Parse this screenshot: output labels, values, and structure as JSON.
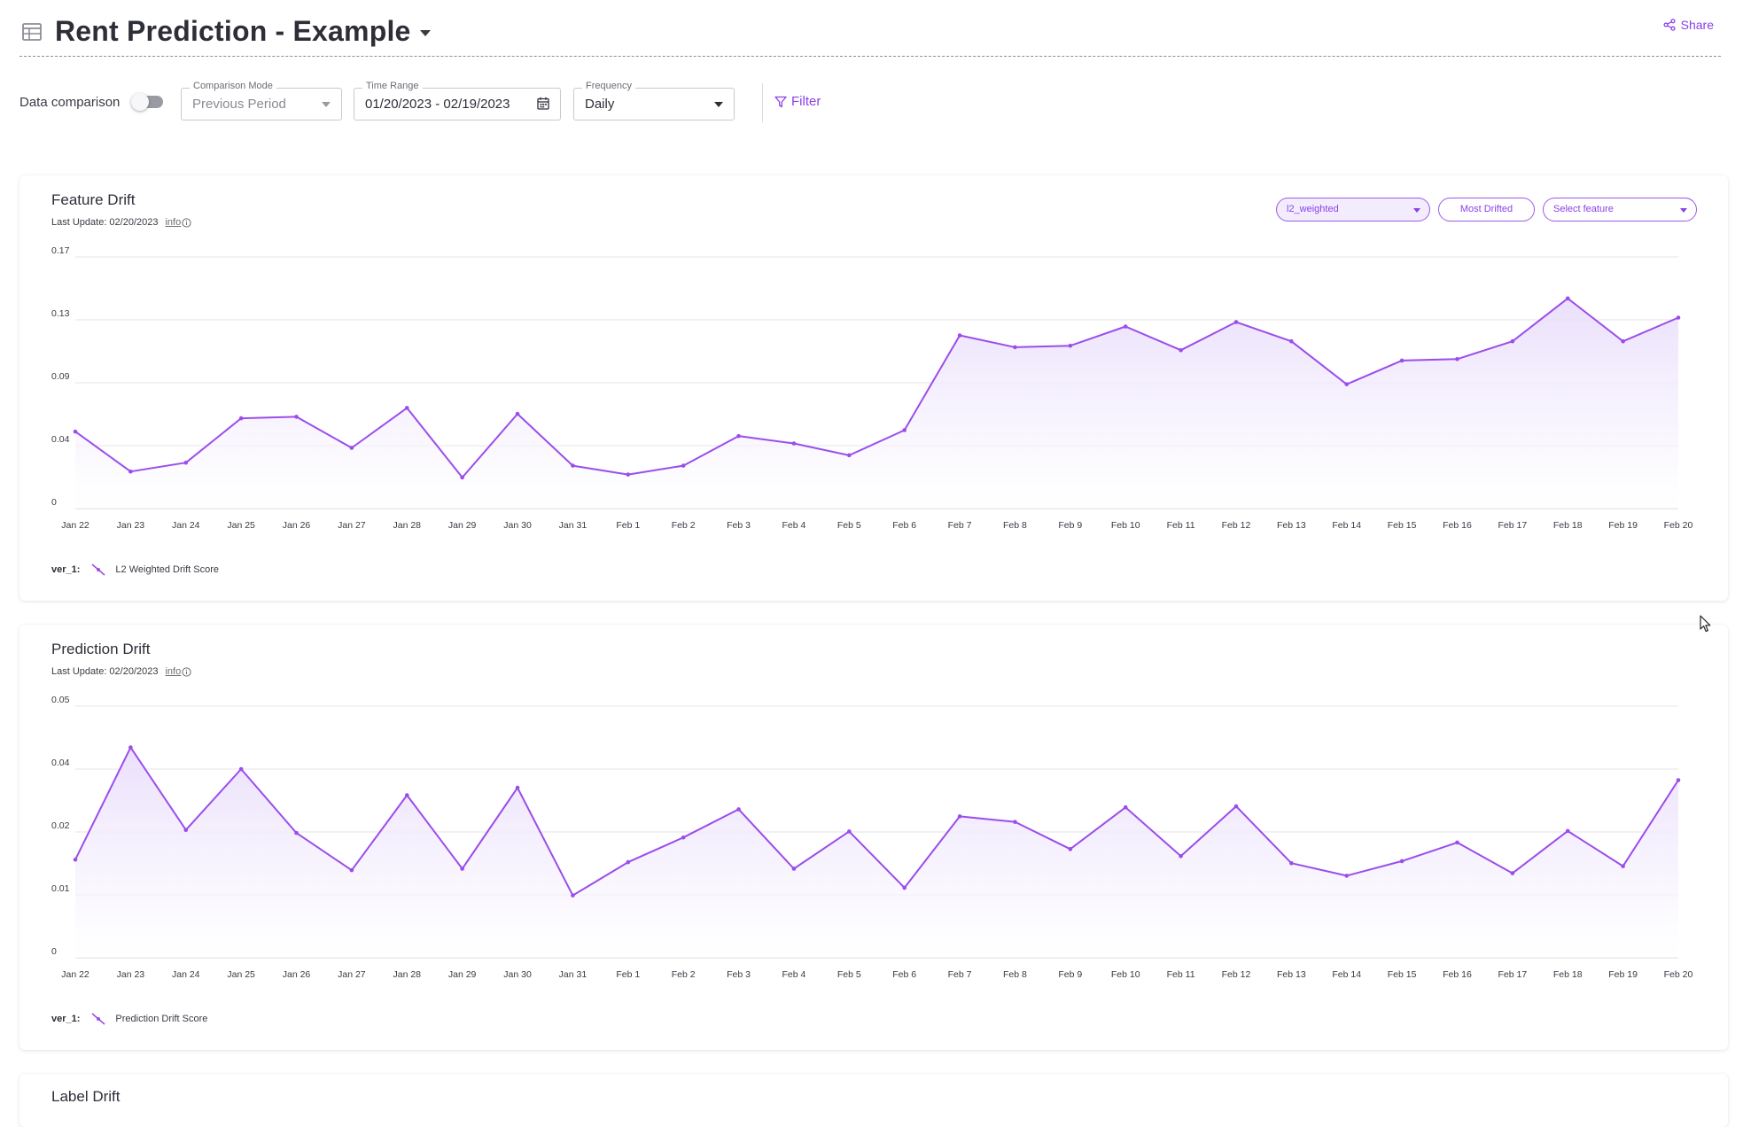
{
  "header": {
    "title": "Rent Prediction - Example",
    "share_label": "Share"
  },
  "toolbar": {
    "data_comparison_label": "Data comparison",
    "data_comparison_enabled": false,
    "comparison_mode": {
      "label": "Comparison Mode",
      "value": "Previous Period"
    },
    "time_range": {
      "label": "Time Range",
      "value": "01/20/2023 - 02/19/2023"
    },
    "frequency": {
      "label": "Frequency",
      "value": "Daily"
    },
    "filter_label": "Filter"
  },
  "colors": {
    "accent": "#8b3fe8",
    "line": "#9b4dea",
    "fill_top": "#e8dcfb"
  },
  "feature_drift": {
    "title": "Feature Drift",
    "last_update": "Last Update: 02/20/2023",
    "info_label": "info",
    "metric_select": "l2_weighted",
    "most_drifted_label": "Most Drifted",
    "feature_select": "Select feature",
    "legend_version": "ver_1:",
    "legend_series": "L2 Weighted Drift Score"
  },
  "prediction_drift": {
    "title": "Prediction Drift",
    "last_update": "Last Update: 02/20/2023",
    "info_label": "info",
    "legend_version": "ver_1:",
    "legend_series": "Prediction Drift Score"
  },
  "label_drift": {
    "title": "Label Drift"
  },
  "chart_data": [
    {
      "type": "area",
      "title": "Feature Drift",
      "categories": [
        "Jan 22",
        "Jan 23",
        "Jan 24",
        "Jan 25",
        "Jan 26",
        "Jan 27",
        "Jan 28",
        "Jan 29",
        "Jan 30",
        "Jan 31",
        "Feb 1",
        "Feb 2",
        "Feb 3",
        "Feb 4",
        "Feb 5",
        "Feb 6",
        "Feb 7",
        "Feb 8",
        "Feb 9",
        "Feb 10",
        "Feb 11",
        "Feb 12",
        "Feb 13",
        "Feb 14",
        "Feb 15",
        "Feb 16",
        "Feb 17",
        "Feb 18",
        "Feb 19",
        "Feb 20"
      ],
      "y_ticks": [
        "0",
        "0.04",
        "0.09",
        "0.13",
        "0.17"
      ],
      "ylim": [
        0,
        0.17
      ],
      "grid": true,
      "series": [
        {
          "name": "L2 Weighted Drift Score",
          "values": [
            0.052,
            0.025,
            0.031,
            0.061,
            0.062,
            0.041,
            0.068,
            0.021,
            0.064,
            0.029,
            0.023,
            0.029,
            0.049,
            0.044,
            0.036,
            0.053,
            0.117,
            0.109,
            0.11,
            0.123,
            0.107,
            0.126,
            0.113,
            0.084,
            0.1,
            0.101,
            0.113,
            0.142,
            0.113,
            0.129
          ]
        }
      ]
    },
    {
      "type": "area",
      "title": "Prediction Drift",
      "categories": [
        "Jan 22",
        "Jan 23",
        "Jan 24",
        "Jan 25",
        "Jan 26",
        "Jan 27",
        "Jan 28",
        "Jan 29",
        "Jan 30",
        "Jan 31",
        "Feb 1",
        "Feb 2",
        "Feb 3",
        "Feb 4",
        "Feb 5",
        "Feb 6",
        "Feb 7",
        "Feb 8",
        "Feb 9",
        "Feb 10",
        "Feb 11",
        "Feb 12",
        "Feb 13",
        "Feb 14",
        "Feb 15",
        "Feb 16",
        "Feb 17",
        "Feb 18",
        "Feb 19",
        "Feb 20"
      ],
      "y_ticks": [
        "0",
        "0.01",
        "0.02",
        "0.04",
        "0.05"
      ],
      "ylim": [
        0,
        0.05
      ],
      "grid": true,
      "series": [
        {
          "name": "Prediction Drift Score",
          "values": [
            0.0195,
            0.0418,
            0.0254,
            0.0375,
            0.0248,
            0.0174,
            0.0323,
            0.0177,
            0.0338,
            0.0124,
            0.019,
            0.0239,
            0.0295,
            0.0177,
            0.0251,
            0.0139,
            0.0281,
            0.027,
            0.0216,
            0.0299,
            0.0202,
            0.0301,
            0.0188,
            0.0163,
            0.0192,
            0.0229,
            0.0168,
            0.0252,
            0.0182,
            0.0353
          ]
        }
      ]
    }
  ]
}
